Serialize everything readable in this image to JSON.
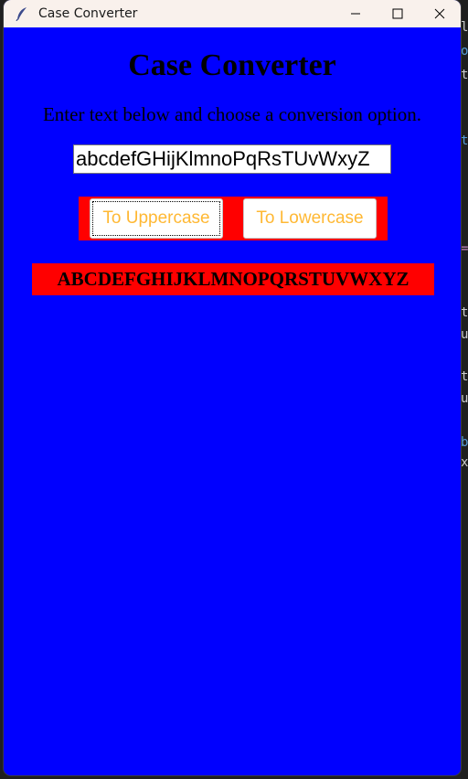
{
  "window": {
    "title": "Case Converter",
    "icon": "feather-icon",
    "controls": {
      "minimize": "minimize-icon",
      "maximize": "maximize-icon",
      "close": "close-icon"
    }
  },
  "app": {
    "heading": "Case Converter",
    "instructions": "Enter text below and choose a conversion option.",
    "input_value": "abcdefGHijKlmnoPqRsTUvWxyZ",
    "buttons": {
      "uppercase_label": "To Uppercase",
      "lowercase_label": "To Lowercase"
    },
    "result": "ABCDEFGHIJKLMNOPQRSTUVWXYZ"
  },
  "background_editor": {
    "fragments": [
      "le",
      "o",
      "t",
      "t",
      "=",
      "t",
      "u",
      "t",
      "u",
      "b",
      "x"
    ]
  },
  "colors": {
    "client_background": "#0000ff",
    "button_text": "#ffb833",
    "accent_red": "#ff0000",
    "titlebar": "#f9f1ec"
  }
}
